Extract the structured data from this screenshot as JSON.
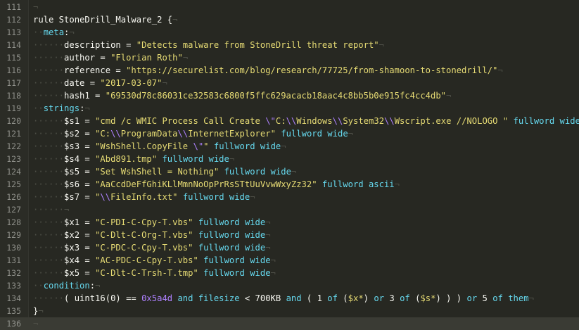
{
  "editor": {
    "first_line_number": 111,
    "current_line": 136,
    "colors": {
      "background": "#272822",
      "text": "#f8f8f2",
      "string": "#e6db74",
      "escape": "#ae81ff",
      "keyword": "#66d9ef",
      "line_number": "#8f908a",
      "whitespace_marker": "#4e4f47"
    },
    "lines": [
      [
        [
          "ws",
          "¬"
        ]
      ],
      [
        [
          "kw",
          "rule StoneDrill_Malware_2 {"
        ],
        [
          "ws",
          "¬"
        ]
      ],
      [
        [
          "ig",
          "··"
        ],
        [
          "sec",
          "meta"
        ],
        [
          "kw",
          ":"
        ],
        [
          "ws",
          "¬"
        ]
      ],
      [
        [
          "ig",
          "······"
        ],
        [
          "var",
          "description = "
        ],
        [
          "str",
          "\"Detects malware from StoneDrill threat report\""
        ],
        [
          "ws",
          "¬"
        ]
      ],
      [
        [
          "ig",
          "······"
        ],
        [
          "var",
          "author = "
        ],
        [
          "str",
          "\"Florian Roth\""
        ],
        [
          "ws",
          "¬"
        ]
      ],
      [
        [
          "ig",
          "······"
        ],
        [
          "var",
          "reference = "
        ],
        [
          "str",
          "\"https://securelist.com/blog/research/77725/from-shamoon-to-stonedrill/\""
        ],
        [
          "ws",
          "¬"
        ]
      ],
      [
        [
          "ig",
          "······"
        ],
        [
          "var",
          "date = "
        ],
        [
          "str",
          "\"2017-03-07\""
        ],
        [
          "ws",
          "¬"
        ]
      ],
      [
        [
          "ig",
          "······"
        ],
        [
          "var",
          "hash1 = "
        ],
        [
          "str",
          "\"69530d78c86031ce32583c6800f5ffc629acacb18aac4c8bb5b0e915fc4cc4db\""
        ],
        [
          "ws",
          "¬"
        ]
      ],
      [
        [
          "ig",
          "··"
        ],
        [
          "sec",
          "strings"
        ],
        [
          "kw",
          ":"
        ],
        [
          "ws",
          "¬"
        ]
      ],
      [
        [
          "ig",
          "······"
        ],
        [
          "var",
          "$s1 = "
        ],
        [
          "str",
          "\"cmd /c WMIC Process Call Create "
        ],
        [
          "esc",
          "\\\""
        ],
        [
          "str",
          "C:"
        ],
        [
          "esc",
          "\\\\"
        ],
        [
          "str",
          "Windows"
        ],
        [
          "esc",
          "\\\\"
        ],
        [
          "str",
          "System32"
        ],
        [
          "esc",
          "\\\\"
        ],
        [
          "str",
          "Wscript.exe //NOLOGO \""
        ],
        [
          "kw",
          " "
        ],
        [
          "mod",
          "fullword wide"
        ]
      ],
      [
        [
          "ig",
          "······"
        ],
        [
          "var",
          "$s2 = "
        ],
        [
          "str",
          "\"C:"
        ],
        [
          "esc",
          "\\\\"
        ],
        [
          "str",
          "ProgramData"
        ],
        [
          "esc",
          "\\\\"
        ],
        [
          "str",
          "InternetExplorer\""
        ],
        [
          "kw",
          " "
        ],
        [
          "mod",
          "fullword wide"
        ],
        [
          "ws",
          "¬"
        ]
      ],
      [
        [
          "ig",
          "······"
        ],
        [
          "var",
          "$s3 = "
        ],
        [
          "str",
          "\"WshShell.CopyFile "
        ],
        [
          "esc",
          "\\\""
        ],
        [
          "str",
          "\""
        ],
        [
          "kw",
          " "
        ],
        [
          "mod",
          "fullword wide"
        ],
        [
          "ws",
          "¬"
        ]
      ],
      [
        [
          "ig",
          "······"
        ],
        [
          "var",
          "$s4 = "
        ],
        [
          "str",
          "\"Abd891.tmp\""
        ],
        [
          "kw",
          " "
        ],
        [
          "mod",
          "fullword wide"
        ],
        [
          "ws",
          "¬"
        ]
      ],
      [
        [
          "ig",
          "······"
        ],
        [
          "var",
          "$s5 = "
        ],
        [
          "str",
          "\"Set WshShell = Nothing\""
        ],
        [
          "kw",
          " "
        ],
        [
          "mod",
          "fullword wide"
        ],
        [
          "ws",
          "¬"
        ]
      ],
      [
        [
          "ig",
          "······"
        ],
        [
          "var",
          "$s6 = "
        ],
        [
          "str",
          "\"AaCcdDeFfGhiKLlMmnNoOpPrRsSTtUuVvwWxyZz32\""
        ],
        [
          "kw",
          " "
        ],
        [
          "mod",
          "fullword ascii"
        ],
        [
          "ws",
          "¬"
        ]
      ],
      [
        [
          "ig",
          "······"
        ],
        [
          "var",
          "$s7 = "
        ],
        [
          "str",
          "\""
        ],
        [
          "esc",
          "\\\\"
        ],
        [
          "str",
          "FileInfo.txt\""
        ],
        [
          "kw",
          " "
        ],
        [
          "mod",
          "fullword wide"
        ],
        [
          "ws",
          "¬"
        ]
      ],
      [
        [
          "ig",
          "······"
        ],
        [
          "ws",
          "¬"
        ]
      ],
      [
        [
          "ig",
          "······"
        ],
        [
          "var",
          "$x1 = "
        ],
        [
          "str",
          "\"C-PDI-C-Cpy-T.vbs\""
        ],
        [
          "kw",
          " "
        ],
        [
          "mod",
          "fullword wide"
        ],
        [
          "ws",
          "¬"
        ]
      ],
      [
        [
          "ig",
          "······"
        ],
        [
          "var",
          "$x2 = "
        ],
        [
          "str",
          "\"C-Dlt-C-Org-T.vbs\""
        ],
        [
          "kw",
          " "
        ],
        [
          "mod",
          "fullword wide"
        ],
        [
          "ws",
          "¬"
        ]
      ],
      [
        [
          "ig",
          "······"
        ],
        [
          "var",
          "$x3 = "
        ],
        [
          "str",
          "\"C-PDC-C-Cpy-T.vbs\""
        ],
        [
          "kw",
          " "
        ],
        [
          "mod",
          "fullword wide"
        ],
        [
          "ws",
          "¬"
        ]
      ],
      [
        [
          "ig",
          "······"
        ],
        [
          "var",
          "$x4 = "
        ],
        [
          "str",
          "\"AC-PDC-C-Cpy-T.vbs\""
        ],
        [
          "kw",
          " "
        ],
        [
          "mod",
          "fullword wide"
        ],
        [
          "ws",
          "¬"
        ]
      ],
      [
        [
          "ig",
          "······"
        ],
        [
          "var",
          "$x5 = "
        ],
        [
          "str",
          "\"C-Dlt-C-Trsh-T.tmp\""
        ],
        [
          "kw",
          " "
        ],
        [
          "mod",
          "fullword wide"
        ],
        [
          "ws",
          "¬"
        ]
      ],
      [
        [
          "ig",
          "··"
        ],
        [
          "sec",
          "condition"
        ],
        [
          "kw",
          ":"
        ],
        [
          "ws",
          "¬"
        ]
      ],
      [
        [
          "ig",
          "······"
        ],
        [
          "kw",
          "( uint16(0) == "
        ],
        [
          "num",
          "0x5a4d"
        ],
        [
          "kw",
          " "
        ],
        [
          "mod",
          "and"
        ],
        [
          "kw",
          " "
        ],
        [
          "mod",
          "filesize"
        ],
        [
          "kw",
          " < 700KB "
        ],
        [
          "mod",
          "and"
        ],
        [
          "kw",
          " ( 1 "
        ],
        [
          "mod",
          "of"
        ],
        [
          "kw",
          " ("
        ],
        [
          "str",
          "$x*"
        ],
        [
          "kw",
          ") "
        ],
        [
          "mod",
          "or"
        ],
        [
          "kw",
          " 3 "
        ],
        [
          "mod",
          "of"
        ],
        [
          "kw",
          " ("
        ],
        [
          "str",
          "$s*"
        ],
        [
          "kw",
          ") ) ) "
        ],
        [
          "mod",
          "or"
        ],
        [
          "kw",
          " 5 "
        ],
        [
          "mod",
          "of"
        ],
        [
          "kw",
          " "
        ],
        [
          "mod",
          "them"
        ],
        [
          "ws",
          "¬"
        ]
      ],
      [
        [
          "kw",
          "}"
        ],
        [
          "ws",
          "¬"
        ]
      ],
      [
        [
          "ws",
          "¬"
        ]
      ]
    ]
  }
}
